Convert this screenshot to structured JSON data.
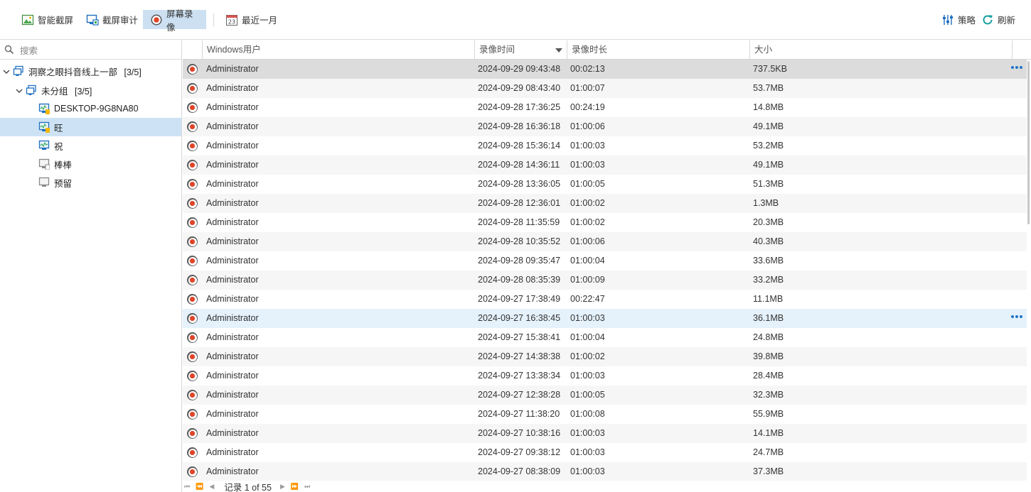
{
  "toolbar": {
    "smart_screenshot": "智能截屏",
    "screenshot_audit": "截屏审计",
    "screen_recording": "屏幕录像",
    "date_range": "最近一月",
    "calendar_day": "23",
    "strategy": "策略",
    "refresh": "刷新"
  },
  "search": {
    "placeholder": "搜索"
  },
  "tree": {
    "root": {
      "label": "洞察之眼抖音线上一部",
      "count": "[3/5]"
    },
    "group": {
      "label": "未分组",
      "count": "[3/5]"
    },
    "devices": [
      {
        "label": "DESKTOP-9G8NA80",
        "status": "online-warn"
      },
      {
        "label": "旺",
        "status": "online-warn"
      },
      {
        "label": "祝",
        "status": "online"
      },
      {
        "label": "棒棒",
        "status": "offline"
      },
      {
        "label": "预留",
        "status": "offline"
      }
    ]
  },
  "grid": {
    "columns": {
      "user": "Windows用户",
      "time": "录像时间",
      "duration": "录像时长",
      "size": "大小"
    },
    "rows": [
      {
        "user": "Administrator",
        "time": "2024-09-29 09:43:48",
        "duration": "00:02:13",
        "size": "737.5KB"
      },
      {
        "user": "Administrator",
        "time": "2024-09-29 08:43:40",
        "duration": "01:00:07",
        "size": "53.7MB"
      },
      {
        "user": "Administrator",
        "time": "2024-09-28 17:36:25",
        "duration": "00:24:19",
        "size": "14.8MB"
      },
      {
        "user": "Administrator",
        "time": "2024-09-28 16:36:18",
        "duration": "01:00:06",
        "size": "49.1MB"
      },
      {
        "user": "Administrator",
        "time": "2024-09-28 15:36:14",
        "duration": "01:00:03",
        "size": "53.2MB"
      },
      {
        "user": "Administrator",
        "time": "2024-09-28 14:36:11",
        "duration": "01:00:03",
        "size": "49.1MB"
      },
      {
        "user": "Administrator",
        "time": "2024-09-28 13:36:05",
        "duration": "01:00:05",
        "size": "51.3MB"
      },
      {
        "user": "Administrator",
        "time": "2024-09-28 12:36:01",
        "duration": "01:00:02",
        "size": "1.3MB"
      },
      {
        "user": "Administrator",
        "time": "2024-09-28 11:35:59",
        "duration": "01:00:02",
        "size": "20.3MB"
      },
      {
        "user": "Administrator",
        "time": "2024-09-28 10:35:52",
        "duration": "01:00:06",
        "size": "40.3MB"
      },
      {
        "user": "Administrator",
        "time": "2024-09-28 09:35:47",
        "duration": "01:00:04",
        "size": "33.6MB"
      },
      {
        "user": "Administrator",
        "time": "2024-09-28 08:35:39",
        "duration": "01:00:09",
        "size": "33.2MB"
      },
      {
        "user": "Administrator",
        "time": "2024-09-27 17:38:49",
        "duration": "00:22:47",
        "size": "11.1MB"
      },
      {
        "user": "Administrator",
        "time": "2024-09-27 16:38:45",
        "duration": "01:00:03",
        "size": "36.1MB"
      },
      {
        "user": "Administrator",
        "time": "2024-09-27 15:38:41",
        "duration": "01:00:04",
        "size": "24.8MB"
      },
      {
        "user": "Administrator",
        "time": "2024-09-27 14:38:38",
        "duration": "01:00:02",
        "size": "39.8MB"
      },
      {
        "user": "Administrator",
        "time": "2024-09-27 13:38:34",
        "duration": "01:00:03",
        "size": "28.4MB"
      },
      {
        "user": "Administrator",
        "time": "2024-09-27 12:38:28",
        "duration": "01:00:05",
        "size": "32.3MB"
      },
      {
        "user": "Administrator",
        "time": "2024-09-27 11:38:20",
        "duration": "01:00:08",
        "size": "55.9MB"
      },
      {
        "user": "Administrator",
        "time": "2024-09-27 10:38:16",
        "duration": "01:00:03",
        "size": "14.1MB"
      },
      {
        "user": "Administrator",
        "time": "2024-09-27 09:38:12",
        "duration": "01:00:03",
        "size": "24.7MB"
      },
      {
        "user": "Administrator",
        "time": "2024-09-27 08:38:09",
        "duration": "01:00:03",
        "size": "37.3MB"
      }
    ],
    "selected_row": 0,
    "hover_row": 13
  },
  "pager": {
    "text": "记录 1 of 55"
  },
  "colors": {
    "accent": "#1f74c9",
    "record_red": "#e0452a",
    "selected_tree": "#cde3f5",
    "active_tab": "#cce0f2"
  }
}
